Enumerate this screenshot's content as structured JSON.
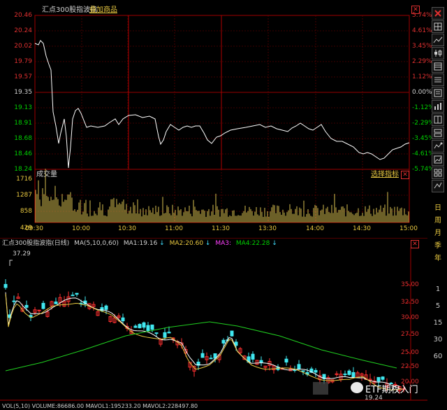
{
  "intraday": {
    "title": "汇点300股指波指",
    "overlay_label": "叠加商品",
    "left_axis": [
      "20.46",
      "20.24",
      "20.02",
      "19.79",
      "19.57",
      "19.35",
      "19.13",
      "18.91",
      "18.68",
      "18.46",
      "18.24"
    ],
    "right_axis": [
      "5.74%",
      "4.61%",
      "3.45%",
      "2.29%",
      "1.12%",
      "0.00%",
      "-1.12%",
      "-2.29%",
      "-3.45%",
      "-4.61%",
      "-5.74%"
    ],
    "colors": {
      "up": "#e03030",
      "down": "#00d000",
      "neutral": "#d0d0d0",
      "grid": "#7a0000"
    }
  },
  "volume": {
    "title": "成交量",
    "select_indicator": "选择指标",
    "axis": [
      "1716",
      "1287",
      "858",
      "429"
    ]
  },
  "time_axis": [
    "09:30",
    "10:00",
    "10:30",
    "11:00",
    "11:30",
    "13:30",
    "14:00",
    "14:30",
    "15:00"
  ],
  "daily": {
    "title": "汇点300股指波指(日线)",
    "ma_prefix": "MA(5,10,0,60)",
    "ma1": "MA1:19.16",
    "ma2": "MA2:20.60",
    "ma3": "MA3:",
    "ma4": "MA4:22.28",
    "arrow": "↓",
    "high_mark": "37.29",
    "low_mark": "19.24",
    "axis": [
      "35.00",
      "32.50",
      "30.00",
      "27.50",
      "25.00",
      "22.50",
      "20.00"
    ],
    "bottom_label": "VOL(5,10)  VOLUME:86686.00   MAVOL1:195233.20   MAVOL2:228497.80"
  },
  "watermark": {
    "text": "ETF期权入门"
  },
  "sidebar": {
    "periods": [
      "日",
      "周",
      "月",
      "季",
      "年"
    ],
    "numbers": [
      "1",
      "5",
      "15",
      "30",
      "60"
    ],
    "icons": [
      "close-icon",
      "grid-icon",
      "line-chart-icon",
      "candlestick-icon",
      "table-icon",
      "list-icon",
      "detail-icon",
      "bar-icon",
      "compare-icon",
      "layout-icon",
      "signal-icon",
      "stats-icon",
      "grid2-icon",
      "text-icon"
    ]
  }
}
